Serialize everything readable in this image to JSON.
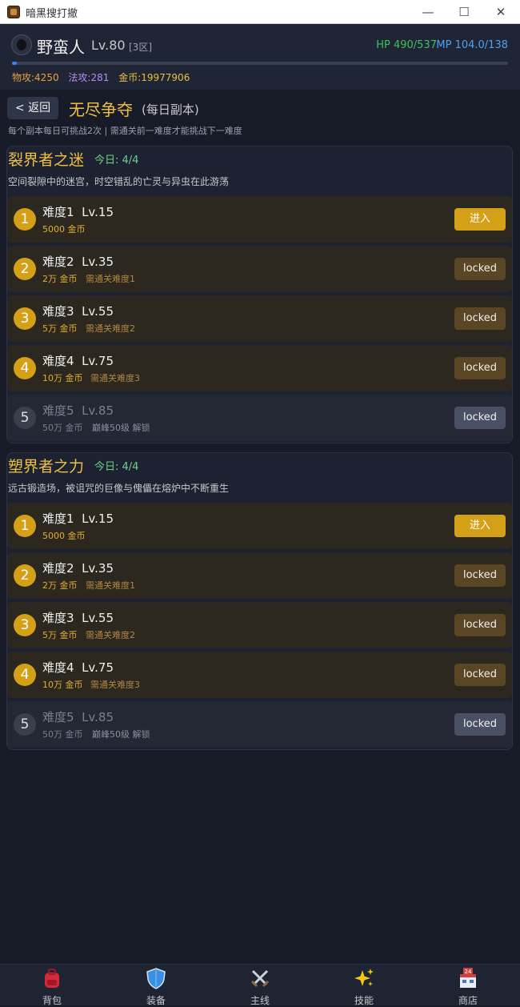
{
  "window": {
    "title": "暗黑搜打撤"
  },
  "header": {
    "name": "野蛮人",
    "level": "Lv.80",
    "zone": "[3区]",
    "hp": "HP 490/537",
    "mp": "MP 104.0/138",
    "exp_progress": 0.01,
    "stats": {
      "phys": "物攻:4250",
      "magic": "法攻:281",
      "gold": "金币:19977906"
    },
    "colors": {
      "phys": "#e8a23a",
      "magic": "#b98cf0",
      "gold": "#e8c040"
    }
  },
  "page": {
    "back_label": "< 返回",
    "title": "无尽争夺",
    "subtitle": "(每日副本)",
    "hint": "每个副本每日可挑战2次 | 需通关前一难度才能挑战下一难度"
  },
  "sections": [
    {
      "title": "裂界者之迷",
      "count": "今日: 4/4",
      "desc": "空间裂隙中的迷宫，时空错乱的亡灵与异虫在此游荡",
      "rows": [
        {
          "num": "1",
          "name": "难度1  Lv.15",
          "gold": "5000 金币",
          "req": "",
          "button": "进入"
        },
        {
          "num": "2",
          "name": "难度2  Lv.35",
          "gold": "2万 金币",
          "req": "需通关难度1",
          "button": "locked"
        },
        {
          "num": "3",
          "name": "难度3  Lv.55",
          "gold": "5万 金币",
          "req": "需通关难度2",
          "button": "locked"
        },
        {
          "num": "4",
          "name": "难度4  Lv.75",
          "gold": "10万 金币",
          "req": "需通关难度3",
          "button": "locked"
        },
        {
          "num": "5",
          "name": "难度5  Lv.85",
          "gold": "50万 金币",
          "req": "巅峰50级 解锁",
          "button": "locked"
        }
      ]
    },
    {
      "title": "塑界者之力",
      "count": "今日: 4/4",
      "desc": "远古锻造场，被诅咒的巨像与傀儡在熔炉中不断重生",
      "rows": [
        {
          "num": "1",
          "name": "难度1  Lv.15",
          "gold": "5000 金币",
          "req": "",
          "button": "进入"
        },
        {
          "num": "2",
          "name": "难度2  Lv.35",
          "gold": "2万 金币",
          "req": "需通关难度1",
          "button": "locked"
        },
        {
          "num": "3",
          "name": "难度3  Lv.55",
          "gold": "5万 金币",
          "req": "需通关难度2",
          "button": "locked"
        },
        {
          "num": "4",
          "name": "难度4  Lv.75",
          "gold": "10万 金币",
          "req": "需通关难度3",
          "button": "locked"
        },
        {
          "num": "5",
          "name": "难度5  Lv.85",
          "gold": "50万 金币",
          "req": "巅峰50级 解锁",
          "button": "locked"
        }
      ]
    }
  ],
  "nav": [
    {
      "label": "背包",
      "icon": "backpack-icon"
    },
    {
      "label": "装备",
      "icon": "shield-icon"
    },
    {
      "label": "主线",
      "icon": "crossed-swords-icon"
    },
    {
      "label": "技能",
      "icon": "sparkles-icon"
    },
    {
      "label": "商店",
      "icon": "store-icon"
    }
  ]
}
